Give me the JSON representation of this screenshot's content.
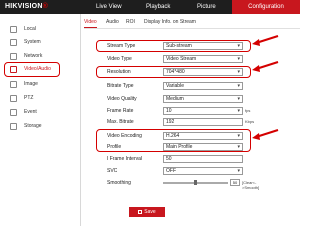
{
  "brand": {
    "name": "HIKVISION",
    "reg": "®"
  },
  "nav": {
    "items": [
      {
        "label": "Live View"
      },
      {
        "label": "Playback"
      },
      {
        "label": "Picture"
      },
      {
        "label": "Configuration"
      }
    ]
  },
  "sidebar": {
    "items": [
      {
        "label": "Local",
        "icon": "monitor-icon"
      },
      {
        "label": "System",
        "icon": "system-icon"
      },
      {
        "label": "Network",
        "icon": "network-icon"
      },
      {
        "label": "Video/Audio",
        "icon": "video-audio-icon"
      },
      {
        "label": "Image",
        "icon": "image-icon"
      },
      {
        "label": "PTZ",
        "icon": "ptz-icon"
      },
      {
        "label": "Event",
        "icon": "event-icon"
      },
      {
        "label": "Storage",
        "icon": "storage-icon"
      }
    ]
  },
  "tabs": [
    {
      "label": "Video"
    },
    {
      "label": "Audio"
    },
    {
      "label": "ROI"
    },
    {
      "label": "Display Info. on Stream"
    }
  ],
  "form": {
    "stream_type": {
      "label": "Stream Type",
      "value": "Sub-stream"
    },
    "video_type": {
      "label": "Video Type",
      "value": "Video Stream"
    },
    "resolution": {
      "label": "Resolution",
      "value": "704*480"
    },
    "bitrate_type": {
      "label": "Bitrate Type",
      "value": "Variable"
    },
    "video_quality": {
      "label": "Video Quality",
      "value": "Medium"
    },
    "frame_rate": {
      "label": "Frame Rate",
      "value": "10",
      "unit": "fps"
    },
    "max_bitrate": {
      "label": "Max. Bitrate",
      "value": "192",
      "unit": "Kbps"
    },
    "video_encoding": {
      "label": "Video Encoding",
      "value": "H.264"
    },
    "profile": {
      "label": "Profile",
      "value": "Main Profile"
    },
    "i_frame_interval": {
      "label": "I Frame Interval",
      "value": "50"
    },
    "svc": {
      "label": "SVC",
      "value": "OFF"
    },
    "smoothing": {
      "label": "Smoothing",
      "value": "50",
      "hint": "[Clear<->Smooth]",
      "level": 0.5
    }
  },
  "save_label": "Save",
  "colors": {
    "accent": "#c8171e",
    "highlight": "#d40000",
    "topbar": "#1e1e1e"
  }
}
